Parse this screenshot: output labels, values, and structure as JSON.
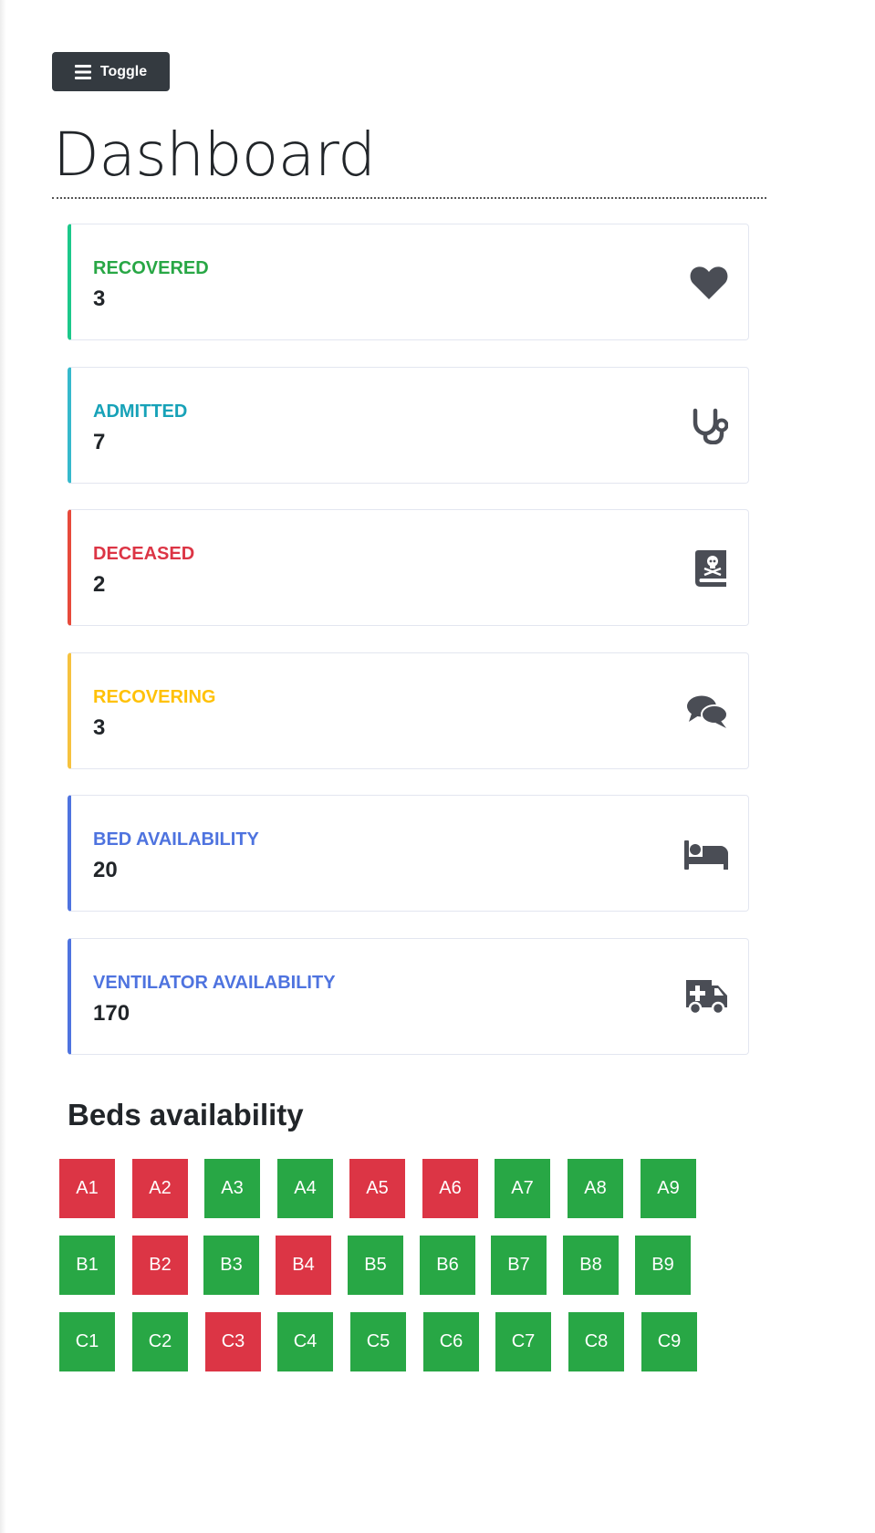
{
  "toggle": {
    "label": "Toggle",
    "icon": "bars-icon"
  },
  "page_title": "Dashboard",
  "cards": [
    {
      "label": "RECOVERED",
      "value": "3",
      "color": "#28a745",
      "border": "#1cc88a",
      "icon": "heart-icon"
    },
    {
      "label": "ADMITTED",
      "value": "7",
      "color": "#17a2b8",
      "border": "#36b9cc",
      "icon": "stethoscope-icon"
    },
    {
      "label": "DECEASED",
      "value": "2",
      "color": "#dc3545",
      "border": "#e74a3b",
      "icon": "skull-book-icon"
    },
    {
      "label": "RECOVERING",
      "value": "3",
      "color": "#ffc107",
      "border": "#f6c23e",
      "icon": "comments-icon"
    },
    {
      "label": "BED AVAILABILITY",
      "value": "20",
      "color": "#4e73df",
      "border": "#4e73df",
      "icon": "bed-icon"
    },
    {
      "label": "VENTILATOR AVAILABILITY",
      "value": "170",
      "color": "#4e73df",
      "border": "#4e73df",
      "icon": "ambulance-icon"
    }
  ],
  "beds_section": {
    "title": "Beds availability",
    "status_colors": {
      "occupied": "#dc3545",
      "available": "#28a745"
    },
    "rows": [
      [
        {
          "label": "A1",
          "status": "occupied"
        },
        {
          "label": "A2",
          "status": "occupied"
        },
        {
          "label": "A3",
          "status": "available"
        },
        {
          "label": "A4",
          "status": "available"
        },
        {
          "label": "A5",
          "status": "occupied"
        },
        {
          "label": "A6",
          "status": "occupied"
        },
        {
          "label": "A7",
          "status": "available"
        },
        {
          "label": "A8",
          "status": "available"
        },
        {
          "label": "A9",
          "status": "available"
        }
      ],
      [
        {
          "label": "B1",
          "status": "available"
        },
        {
          "label": "B2",
          "status": "occupied"
        },
        {
          "label": "B3",
          "status": "available"
        },
        {
          "label": "B4",
          "status": "occupied"
        },
        {
          "label": "B5",
          "status": "available"
        },
        {
          "label": "B6",
          "status": "available"
        },
        {
          "label": "B7",
          "status": "available"
        },
        {
          "label": "B8",
          "status": "available"
        },
        {
          "label": "B9",
          "status": "available"
        }
      ],
      [
        {
          "label": "C1",
          "status": "available"
        },
        {
          "label": "C2",
          "status": "available"
        },
        {
          "label": "C3",
          "status": "occupied"
        },
        {
          "label": "C4",
          "status": "available"
        },
        {
          "label": "C5",
          "status": "available"
        },
        {
          "label": "C6",
          "status": "available"
        },
        {
          "label": "C7",
          "status": "available"
        },
        {
          "label": "C8",
          "status": "available"
        },
        {
          "label": "C9",
          "status": "available"
        }
      ]
    ]
  }
}
